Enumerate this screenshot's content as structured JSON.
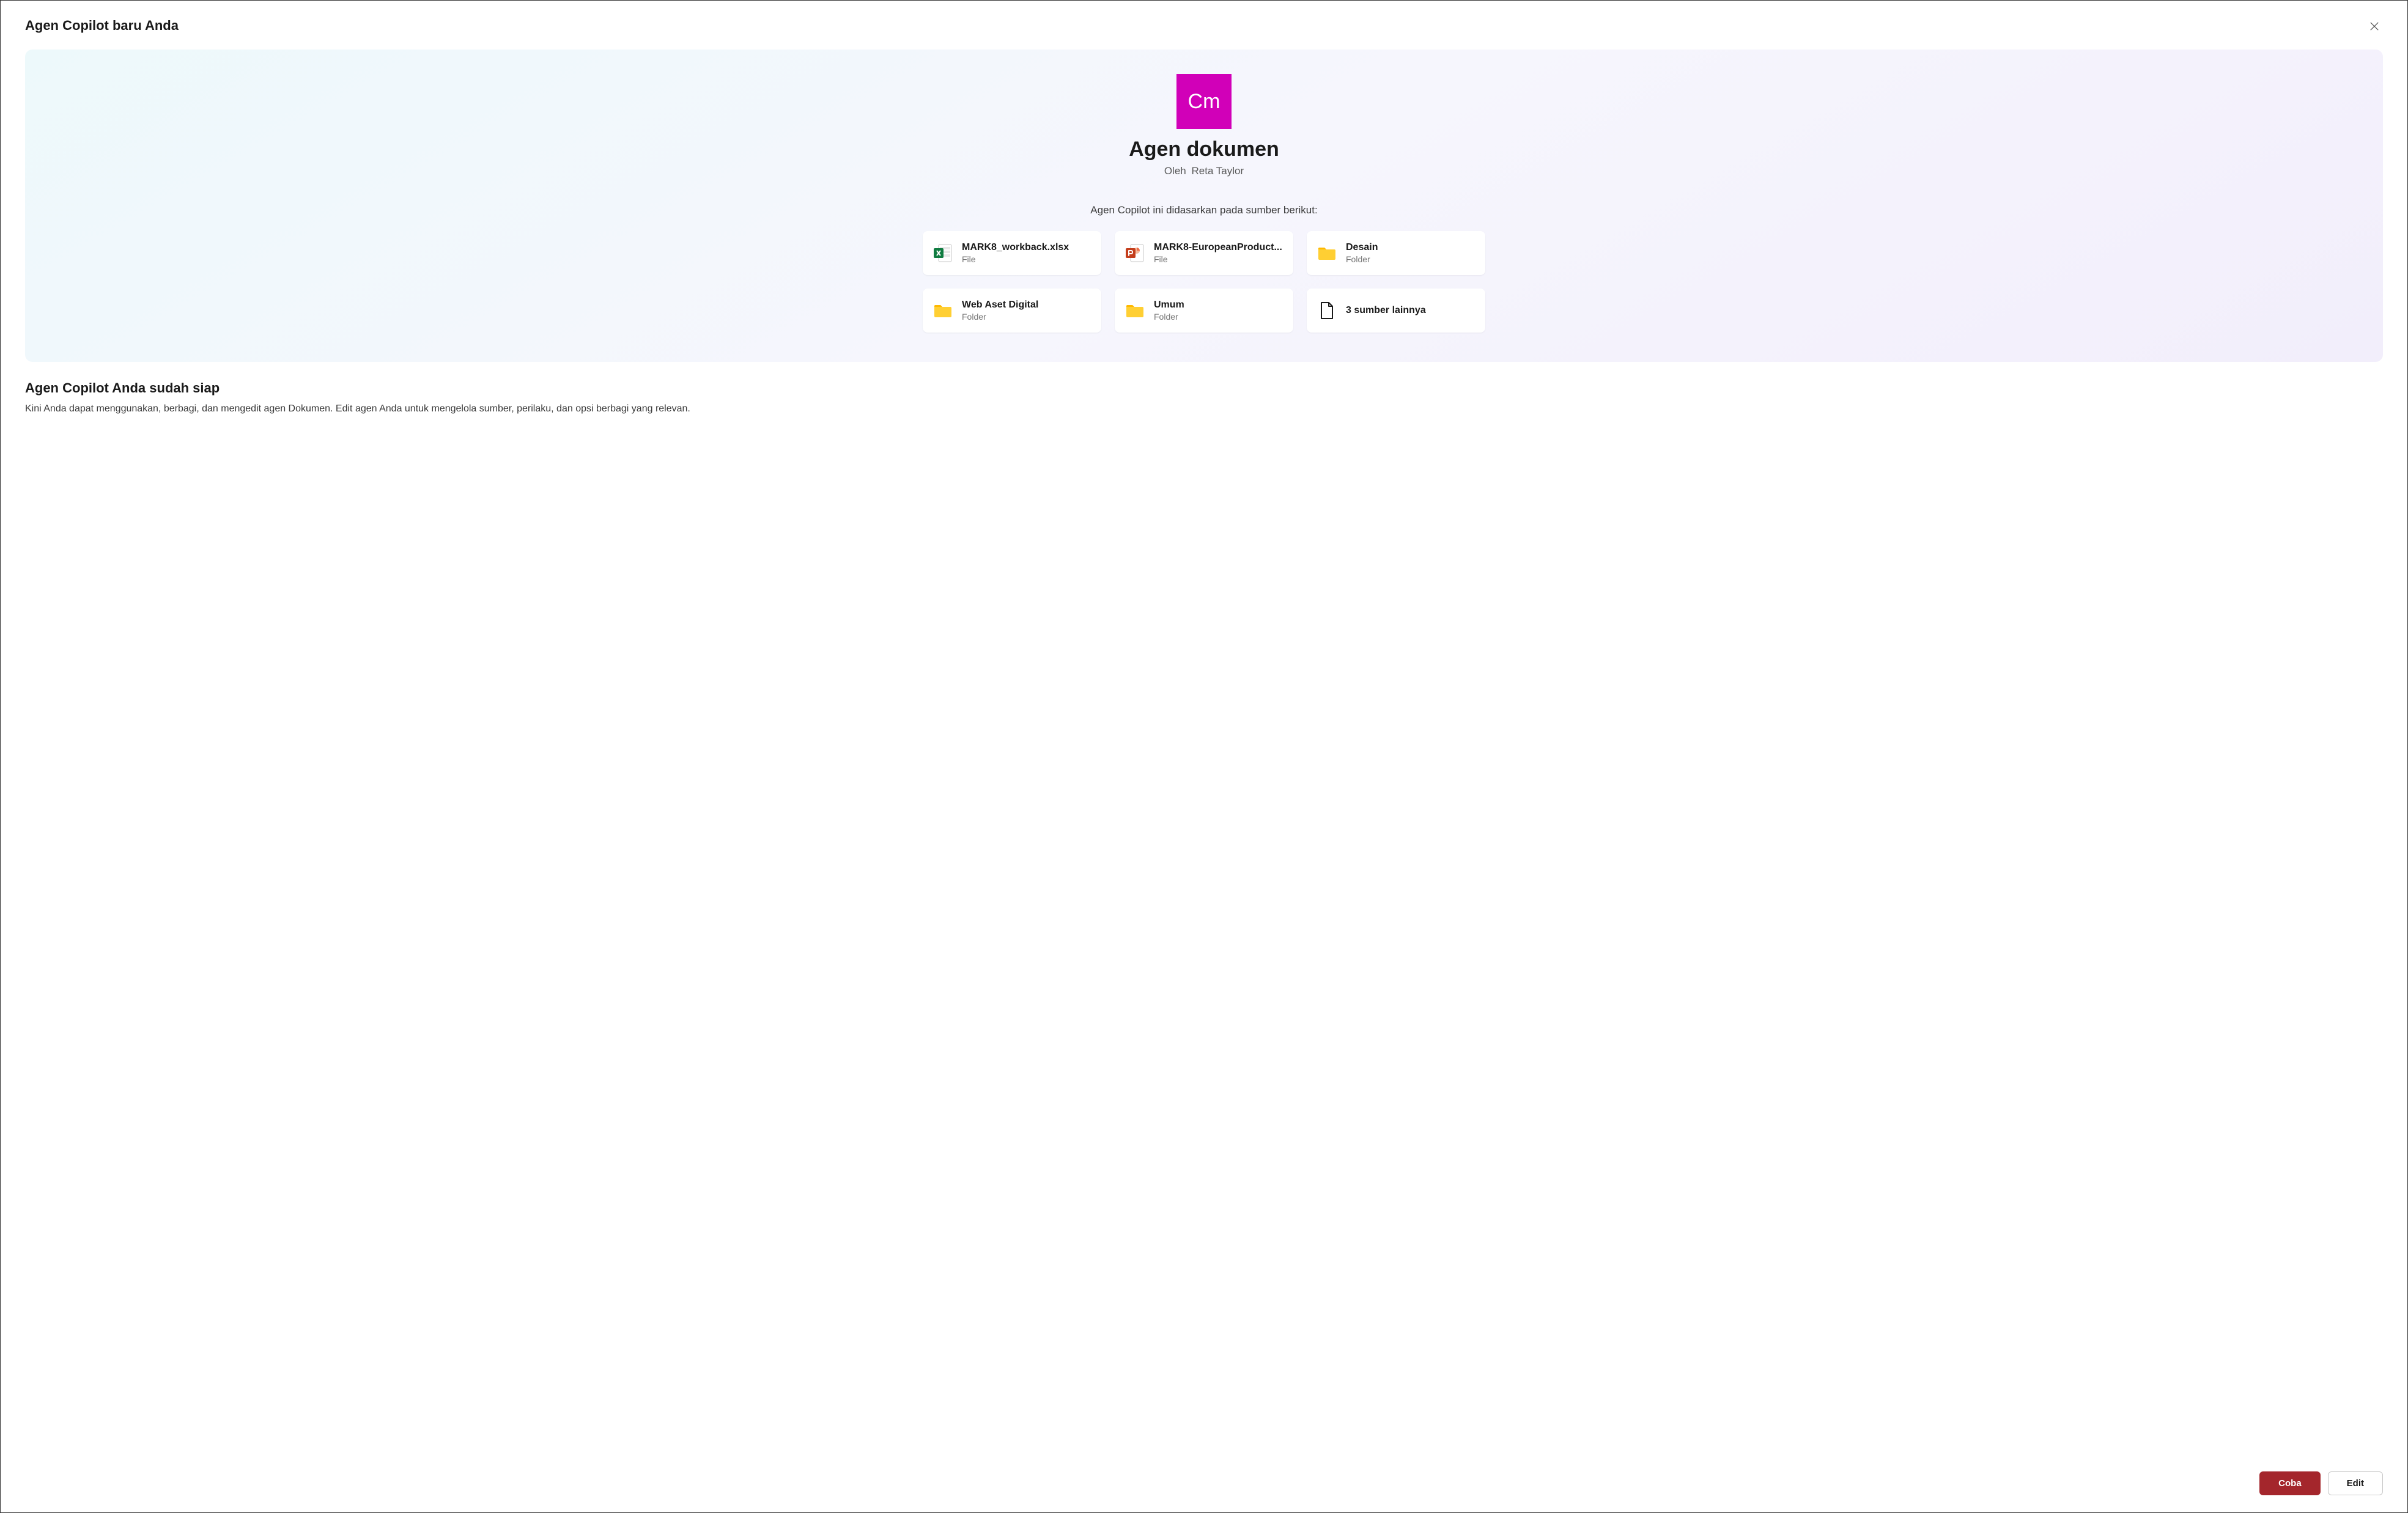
{
  "dialog": {
    "title": "Agen Copilot baru Anda"
  },
  "agent": {
    "icon_initials": "Cm",
    "name": "Agen dokumen",
    "by_label": "Oleh",
    "author": "Reta Taylor"
  },
  "sources_intro": "Agen Copilot ini didasarkan pada sumber berikut:",
  "sources": [
    {
      "name": "MARK8_workback.xlsx",
      "type": "File",
      "icon": "excel"
    },
    {
      "name": "MARK8-EuropeanProduct...",
      "type": "File",
      "icon": "powerpoint"
    },
    {
      "name": "Desain",
      "type": "Folder",
      "icon": "folder"
    },
    {
      "name": "Web Aset Digital",
      "type": "Folder",
      "icon": "folder"
    },
    {
      "name": "Umum",
      "type": "Folder",
      "icon": "folder"
    }
  ],
  "more_sources": {
    "label": "3 sumber lainnya"
  },
  "ready": {
    "title": "Agen Copilot Anda sudah siap",
    "description": "Kini Anda dapat menggunakan, berbagi, dan mengedit agen Dokumen. Edit agen Anda untuk mengelola sumber, perilaku, dan opsi berbagi yang relevan."
  },
  "actions": {
    "primary": "Coba",
    "secondary": "Edit"
  }
}
